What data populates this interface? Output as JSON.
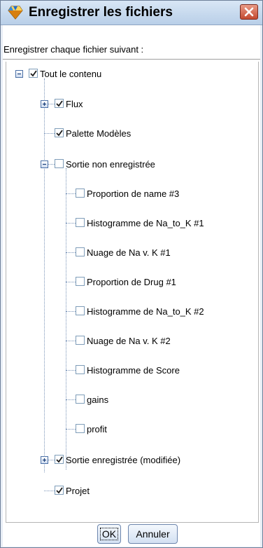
{
  "window": {
    "title": "Enregistrer les fichiers",
    "title_icon": "diamond-icon",
    "close_icon": "close-icon"
  },
  "caption": "Enregistrer chaque fichier suivant :",
  "tree": [
    {
      "label": "Tout le contenu",
      "checked": true,
      "expander": "minus"
    },
    {
      "label": "Flux",
      "checked": true,
      "expander": "plus"
    },
    {
      "label": "Palette Modèles",
      "checked": true,
      "expander": null
    },
    {
      "label": "Sortie non enregistrée",
      "checked": false,
      "expander": "minus"
    },
    {
      "label": "Proportion de name #3",
      "checked": false
    },
    {
      "label": "Histogramme de Na_to_K #1",
      "checked": false
    },
    {
      "label": "Nuage de Na v. K #1",
      "checked": false
    },
    {
      "label": "Proportion de Drug #1",
      "checked": false
    },
    {
      "label": "Histogramme de Na_to_K #2",
      "checked": false
    },
    {
      "label": "Nuage de Na v. K #2",
      "checked": false
    },
    {
      "label": "Histogramme de Score",
      "checked": false
    },
    {
      "label": "gains",
      "checked": false
    },
    {
      "label": "profit",
      "checked": false
    },
    {
      "label": "Sortie enregistrée (modifiée)",
      "checked": true,
      "expander": "plus"
    },
    {
      "label": "Projet",
      "checked": true,
      "expander": null
    }
  ],
  "buttons": {
    "ok": "OK",
    "cancel": "Annuler"
  },
  "colors": {
    "titlebar": "#c6d9ee",
    "close": "#c44a30",
    "tree_lines": "#7a94b8"
  }
}
